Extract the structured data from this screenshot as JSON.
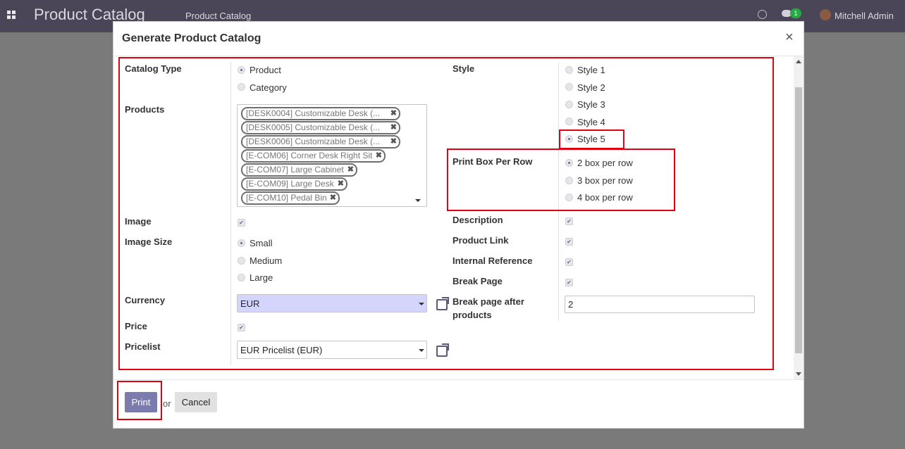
{
  "navbar": {
    "app_title": "Product Catalog",
    "menu_item": "Product Catalog",
    "chat_badge": "1",
    "user_name": "Mitchell Admin"
  },
  "modal": {
    "title": "Generate Product Catalog",
    "close_label": "×"
  },
  "form": {
    "catalog_type": {
      "label": "Catalog Type",
      "options": [
        "Product",
        "Category"
      ],
      "selected": "Product"
    },
    "products": {
      "label": "Products",
      "tags": [
        "[DESK0004] Customizable Desk (...",
        "[DESK0005] Customizable Desk (...",
        "[DESK0006] Customizable Desk (...",
        "[E-COM06] Corner Desk Right Sit",
        "[E-COM07] Large Cabinet",
        "[E-COM09] Large Desk",
        "[E-COM10] Pedal Bin"
      ]
    },
    "image": {
      "label": "Image",
      "checked": true
    },
    "image_size": {
      "label": "Image Size",
      "options": [
        "Small",
        "Medium",
        "Large"
      ],
      "selected": "Small"
    },
    "currency": {
      "label": "Currency",
      "value": "EUR"
    },
    "price": {
      "label": "Price",
      "checked": true
    },
    "pricelist": {
      "label": "Pricelist",
      "value": "EUR Pricelist (EUR)"
    },
    "style": {
      "label": "Style",
      "options": [
        "Style 1",
        "Style 2",
        "Style 3",
        "Style 4",
        "Style 5"
      ],
      "selected": "Style 5"
    },
    "print_box": {
      "label": "Print Box Per Row",
      "options": [
        "2 box per row",
        "3 box per row",
        "4 box per row"
      ],
      "selected": "2 box per row"
    },
    "description": {
      "label": "Description",
      "checked": true
    },
    "product_link": {
      "label": "Product Link",
      "checked": true
    },
    "internal_reference": {
      "label": "Internal Reference",
      "checked": true
    },
    "break_page": {
      "label": "Break Page",
      "checked": true
    },
    "break_after": {
      "label_line1": "Break page after",
      "label_line2": "products",
      "value": "2"
    }
  },
  "footer": {
    "print_label": "Print",
    "or_label": "or",
    "cancel_label": "Cancel"
  },
  "colors": {
    "navbar": "#4a4657",
    "primary_button": "#7c7bad",
    "highlight": "#e3000f",
    "currency_bg": "#d5d4fc"
  },
  "icons": [
    "apps-grid-icon",
    "clock-icon",
    "chat-icon",
    "user-avatar",
    "close-icon",
    "external-link-icon",
    "dropdown-caret-icon",
    "tag-remove-icon"
  ]
}
